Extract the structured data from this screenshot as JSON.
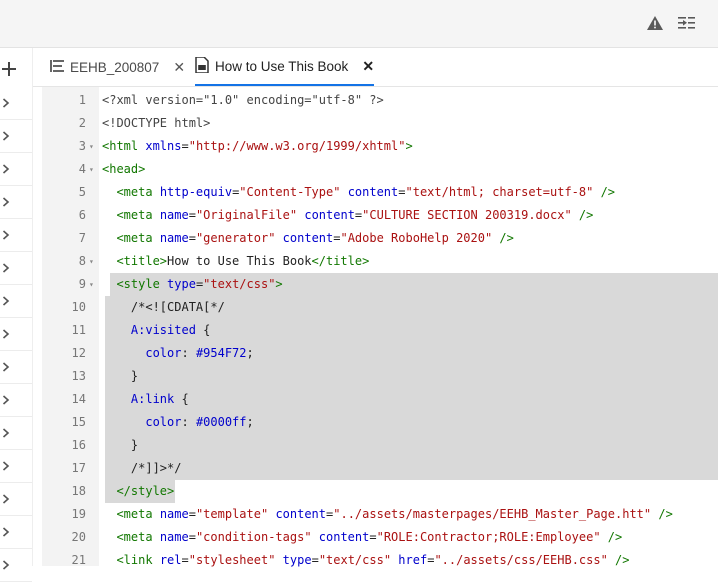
{
  "tabs": [
    {
      "label": "EEHB_200807",
      "close": "✕",
      "active": false
    },
    {
      "label": "How to Use This Book",
      "close": "✕",
      "active": true
    }
  ],
  "icons": {
    "warning": "warning-icon",
    "collapse_panel": "collapse-panel-icon",
    "add": "plus-icon",
    "rail": "chevron-right-icon"
  },
  "colors": {
    "accent": "#1473e6",
    "selection": "#d9d9d9",
    "tag": "#117700",
    "attr": "#0000cc",
    "string": "#aa1111"
  },
  "lines": [
    {
      "n": "1",
      "fold": "",
      "tokens": [
        {
          "t": "<?xml version=\"1.0\" encoding=\"utf-8\" ?>",
          "c": "pi"
        }
      ]
    },
    {
      "n": "2",
      "fold": "",
      "tokens": [
        {
          "t": "<!DOCTYPE html>",
          "c": "pi"
        }
      ]
    },
    {
      "n": "3",
      "fold": "▾",
      "tokens": [
        {
          "t": "<html ",
          "c": "tag"
        },
        {
          "t": "xmlns",
          "c": "attr"
        },
        {
          "t": "=",
          "c": "txt"
        },
        {
          "t": "\"http://www.w3.org/1999/xhtml\"",
          "c": "str"
        },
        {
          "t": ">",
          "c": "tag"
        }
      ]
    },
    {
      "n": "4",
      "fold": "▾",
      "tokens": [
        {
          "t": "<head>",
          "c": "tag"
        }
      ]
    },
    {
      "n": "5",
      "fold": "",
      "tokens": [
        {
          "t": "  ",
          "c": "txt"
        },
        {
          "t": "<meta ",
          "c": "tag"
        },
        {
          "t": "http-equiv",
          "c": "attr"
        },
        {
          "t": "=",
          "c": "txt"
        },
        {
          "t": "\"Content-Type\"",
          "c": "str"
        },
        {
          "t": " ",
          "c": "txt"
        },
        {
          "t": "content",
          "c": "attr"
        },
        {
          "t": "=",
          "c": "txt"
        },
        {
          "t": "\"text/html; charset=utf-8\"",
          "c": "str"
        },
        {
          "t": " />",
          "c": "tag"
        }
      ]
    },
    {
      "n": "6",
      "fold": "",
      "tokens": [
        {
          "t": "  ",
          "c": "txt"
        },
        {
          "t": "<meta ",
          "c": "tag"
        },
        {
          "t": "name",
          "c": "attr"
        },
        {
          "t": "=",
          "c": "txt"
        },
        {
          "t": "\"OriginalFile\"",
          "c": "str"
        },
        {
          "t": " ",
          "c": "txt"
        },
        {
          "t": "content",
          "c": "attr"
        },
        {
          "t": "=",
          "c": "txt"
        },
        {
          "t": "\"CULTURE SECTION 200319.docx\"",
          "c": "str"
        },
        {
          "t": " />",
          "c": "tag"
        }
      ]
    },
    {
      "n": "7",
      "fold": "",
      "tokens": [
        {
          "t": "  ",
          "c": "txt"
        },
        {
          "t": "<meta ",
          "c": "tag"
        },
        {
          "t": "name",
          "c": "attr"
        },
        {
          "t": "=",
          "c": "txt"
        },
        {
          "t": "\"generator\"",
          "c": "str"
        },
        {
          "t": " ",
          "c": "txt"
        },
        {
          "t": "content",
          "c": "attr"
        },
        {
          "t": "=",
          "c": "txt"
        },
        {
          "t": "\"Adobe RoboHelp 2020\"",
          "c": "str"
        },
        {
          "t": " />",
          "c": "tag"
        }
      ]
    },
    {
      "n": "8",
      "fold": "▾",
      "tokens": [
        {
          "t": "  ",
          "c": "txt"
        },
        {
          "t": "<title>",
          "c": "tag"
        },
        {
          "t": "How to Use This Book",
          "c": "txt"
        },
        {
          "t": "</title>",
          "c": "tag"
        }
      ]
    },
    {
      "n": "9",
      "fold": "▾",
      "tokens": [
        {
          "t": "  ",
          "c": "txt"
        },
        {
          "t": "<style ",
          "c": "tag"
        },
        {
          "t": "type",
          "c": "attr"
        },
        {
          "t": "=",
          "c": "txt"
        },
        {
          "t": "\"text/css\"",
          "c": "str"
        },
        {
          "t": ">",
          "c": "tag"
        }
      ]
    },
    {
      "n": "10",
      "fold": "",
      "tokens": [
        {
          "t": "    /*<![CDATA[*/",
          "c": "txt"
        }
      ]
    },
    {
      "n": "11",
      "fold": "",
      "tokens": [
        {
          "t": "    ",
          "c": "txt"
        },
        {
          "t": "A:visited",
          "c": "kw"
        },
        {
          "t": " {",
          "c": "txt"
        }
      ]
    },
    {
      "n": "12",
      "fold": "",
      "tokens": [
        {
          "t": "      ",
          "c": "txt"
        },
        {
          "t": "color",
          "c": "kw"
        },
        {
          "t": ": ",
          "c": "txt"
        },
        {
          "t": "#954F72",
          "c": "kw"
        },
        {
          "t": ";",
          "c": "txt"
        }
      ]
    },
    {
      "n": "13",
      "fold": "",
      "tokens": [
        {
          "t": "    }",
          "c": "txt"
        }
      ]
    },
    {
      "n": "14",
      "fold": "",
      "tokens": [
        {
          "t": "    ",
          "c": "txt"
        },
        {
          "t": "A:link",
          "c": "kw"
        },
        {
          "t": " {",
          "c": "txt"
        }
      ]
    },
    {
      "n": "15",
      "fold": "",
      "tokens": [
        {
          "t": "      ",
          "c": "txt"
        },
        {
          "t": "color",
          "c": "kw"
        },
        {
          "t": ": ",
          "c": "txt"
        },
        {
          "t": "#0000ff",
          "c": "kw"
        },
        {
          "t": ";",
          "c": "txt"
        }
      ]
    },
    {
      "n": "16",
      "fold": "",
      "tokens": [
        {
          "t": "    }",
          "c": "txt"
        }
      ]
    },
    {
      "n": "17",
      "fold": "",
      "tokens": [
        {
          "t": "    /*]]>*/",
          "c": "txt"
        }
      ]
    },
    {
      "n": "18",
      "fold": "",
      "tokens": [
        {
          "t": "  ",
          "c": "txt"
        },
        {
          "t": "</style>",
          "c": "tag"
        }
      ]
    },
    {
      "n": "19",
      "fold": "",
      "tokens": [
        {
          "t": "  ",
          "c": "txt"
        },
        {
          "t": "<meta ",
          "c": "tag"
        },
        {
          "t": "name",
          "c": "attr"
        },
        {
          "t": "=",
          "c": "txt"
        },
        {
          "t": "\"template\"",
          "c": "str"
        },
        {
          "t": " ",
          "c": "txt"
        },
        {
          "t": "content",
          "c": "attr"
        },
        {
          "t": "=",
          "c": "txt"
        },
        {
          "t": "\"../assets/masterpages/EEHB_Master_Page.htt\"",
          "c": "str"
        },
        {
          "t": " />",
          "c": "tag"
        }
      ]
    },
    {
      "n": "20",
      "fold": "",
      "tokens": [
        {
          "t": "  ",
          "c": "txt"
        },
        {
          "t": "<meta ",
          "c": "tag"
        },
        {
          "t": "name",
          "c": "attr"
        },
        {
          "t": "=",
          "c": "txt"
        },
        {
          "t": "\"condition-tags\"",
          "c": "str"
        },
        {
          "t": " ",
          "c": "txt"
        },
        {
          "t": "content",
          "c": "attr"
        },
        {
          "t": "=",
          "c": "txt"
        },
        {
          "t": "\"ROLE:Contractor;ROLE:Employee\"",
          "c": "str"
        },
        {
          "t": " />",
          "c": "tag"
        }
      ]
    },
    {
      "n": "21",
      "fold": "",
      "tokens": [
        {
          "t": "  ",
          "c": "txt"
        },
        {
          "t": "<link ",
          "c": "tag"
        },
        {
          "t": "rel",
          "c": "attr"
        },
        {
          "t": "=",
          "c": "txt"
        },
        {
          "t": "\"stylesheet\"",
          "c": "str"
        },
        {
          "t": " ",
          "c": "txt"
        },
        {
          "t": "type",
          "c": "attr"
        },
        {
          "t": "=",
          "c": "txt"
        },
        {
          "t": "\"text/css\"",
          "c": "str"
        },
        {
          "t": " ",
          "c": "txt"
        },
        {
          "t": "href",
          "c": "attr"
        },
        {
          "t": "=",
          "c": "txt"
        },
        {
          "t": "\"../assets/css/EEHB.css\"",
          "c": "str"
        },
        {
          "t": " />",
          "c": "tag"
        }
      ]
    }
  ],
  "selection": {
    "first_line": 9,
    "last_line": 18
  }
}
